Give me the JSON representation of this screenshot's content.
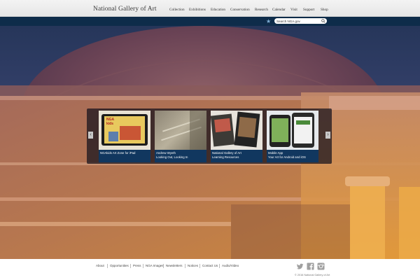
{
  "header": {
    "site_title": "National Gallery of Art",
    "nav": [
      "Collection",
      "Exhibitions",
      "Education",
      "Conservation",
      "Research",
      "Calendar",
      "Visit",
      "Support",
      "Shop"
    ]
  },
  "search": {
    "placeholder": "Search NGA.gov",
    "icon": "search-icon",
    "star_icon": "star-icon"
  },
  "carousel": {
    "prev_icon": "‹",
    "next_icon": "›",
    "slides": [
      {
        "line1": "NGAkids Art Zone for iPad",
        "line2": "",
        "thumb_text": "NGA kids"
      },
      {
        "line1": "Andrew Wyeth",
        "line2": "Looking Out, Looking In",
        "thumb_text": ""
      },
      {
        "line1": "National Gallery of Art",
        "line2": "Learning Resources",
        "thumb_text": ""
      },
      {
        "line1": "Mobile App",
        "line2": "Your Art for Android and iOS",
        "thumb_text": ""
      }
    ]
  },
  "footer": {
    "links": [
      "About",
      "Opportunities",
      "Press",
      "NGA Images",
      "Newsletters",
      "Notices",
      "Contact Us",
      "Audio/Video"
    ],
    "social_icons": [
      "twitter-icon",
      "facebook-icon",
      "instagram-icon"
    ],
    "copyright": "© 2016 National Gallery of Art"
  },
  "colors": {
    "header_bg": "#eeeeee",
    "search_bar_bg": "#0e2c4a",
    "caption_bg": "#11375f"
  }
}
